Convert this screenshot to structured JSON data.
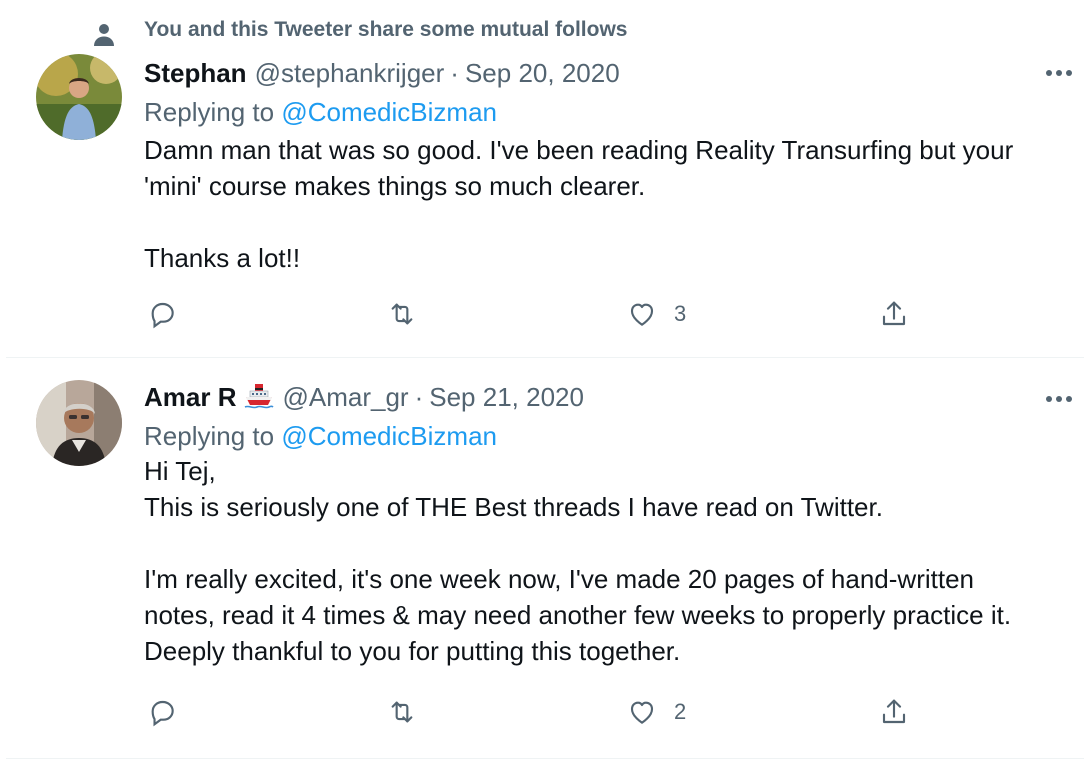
{
  "colors": {
    "text": "#0f1419",
    "secondary": "#536471",
    "link": "#1d9bf0",
    "divider": "#eff3f4"
  },
  "tweets": [
    {
      "social_context": "You and this Tweeter share some mutual follows",
      "social_context_icon": "person-icon",
      "name": "Stephan",
      "handle": "@stephankrijger",
      "separator": "·",
      "date": "Sep 20, 2020",
      "replying_prefix": "Replying to",
      "replying_to": "@ComedicBizman",
      "text": "Damn man that was so good. I've been reading Reality Transurfing but your\n'mini' course makes things so much clearer.\n\nThanks a lot!!",
      "actions": {
        "reply": "",
        "retweet": "",
        "like": "3",
        "share": ""
      }
    },
    {
      "name": "Amar R",
      "name_badge_icon": "ship-emoji-icon",
      "handle": "@Amar_gr",
      "separator": "·",
      "date": "Sep 21, 2020",
      "replying_prefix": "Replying to",
      "replying_to": "@ComedicBizman",
      "text": "Hi Tej,\nThis is seriously one of THE Best threads I have read on Twitter.\n\nI'm really excited, it's one week now, I've made 20 pages of hand-written\nnotes, read it 4 times & may need another few weeks to properly practice it.\nDeeply thankful to you for putting this together.",
      "actions": {
        "reply": "",
        "retweet": "",
        "like": "2",
        "share": ""
      }
    }
  ]
}
